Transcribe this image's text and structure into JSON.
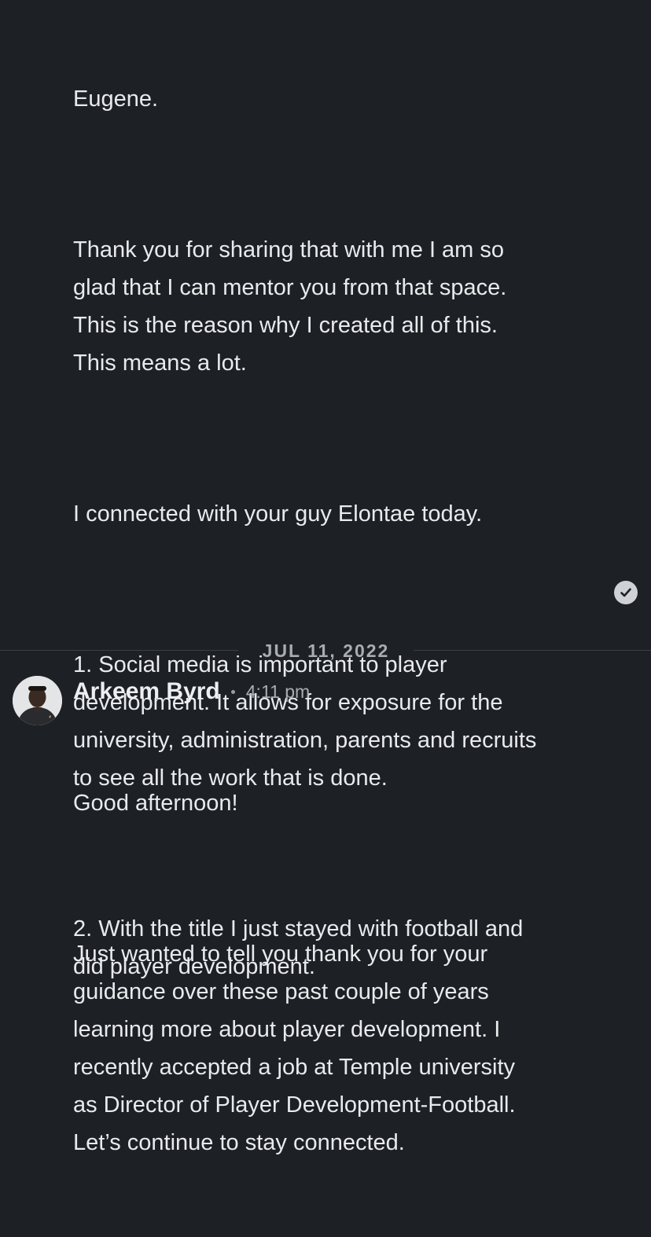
{
  "messages": [
    {
      "paragraphs": [
        "Eugene.",
        "Thank you for sharing that with me I am so\nglad that I can mentor you from that space.\nThis is the reason why I created all of this.\nThis means a lot.",
        "I connected with your guy Elontae today.",
        "1. Social media is important to player\ndevelopment. It allows for exposure for the\nuniversity, administration, parents and recruits\nto see all the work that is done.",
        "2. With the title I just stayed with football and\ndid player development."
      ],
      "status_icon": "check-circle-icon"
    },
    {
      "sender": "Arkeem Byrd",
      "time": "4:11 pm",
      "paragraphs": [
        "Good afternoon!",
        "Just wanted to tell you thank you for your\nguidance over these past couple of years\nlearning more about player development. I\nrecently accepted a job at Temple university\nas Director of Player Development-Football.\nLet’s continue to stay connected."
      ]
    }
  ],
  "date_divider": "JUL 11, 2022",
  "colors": {
    "background": "#1d2025",
    "text": "#e9eaec",
    "muted": "#a9acb1",
    "divider": "#3c4047"
  }
}
